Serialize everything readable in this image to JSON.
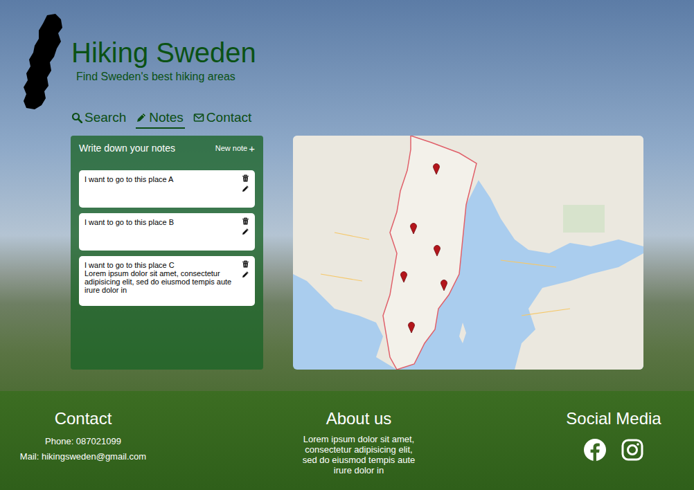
{
  "brand": {
    "title": "Hiking Sweden",
    "tagline": "Find Sweden's best hiking areas"
  },
  "nav": [
    {
      "label": "Search",
      "selected": false
    },
    {
      "label": "Notes",
      "selected": true
    },
    {
      "label": "Contact",
      "selected": false
    }
  ],
  "notes_panel": {
    "title": "Write down your notes",
    "new_note": "New note",
    "new_note_icon": "+",
    "notes": [
      {
        "text": "I want to go to this place A"
      },
      {
        "text": "I want to go to this place B"
      },
      {
        "text": "I want to go to this place C\nLorem ipsum dolor sit amet, consectetur adipisicing elit, sed do eiusmod tempis aute irure dolor in"
      }
    ]
  },
  "footer": {
    "contact": {
      "title": "Contact",
      "phone": "Phone: 087021099",
      "mail": "Mail: hikingsweden@gmail.com"
    },
    "about": {
      "title": "About us",
      "text": "Lorem ipsum dolor sit amet, consectetur adipisicing elit, sed do eiusmod tempis aute irure dolor in"
    },
    "social": {
      "title": "Social Media"
    }
  }
}
